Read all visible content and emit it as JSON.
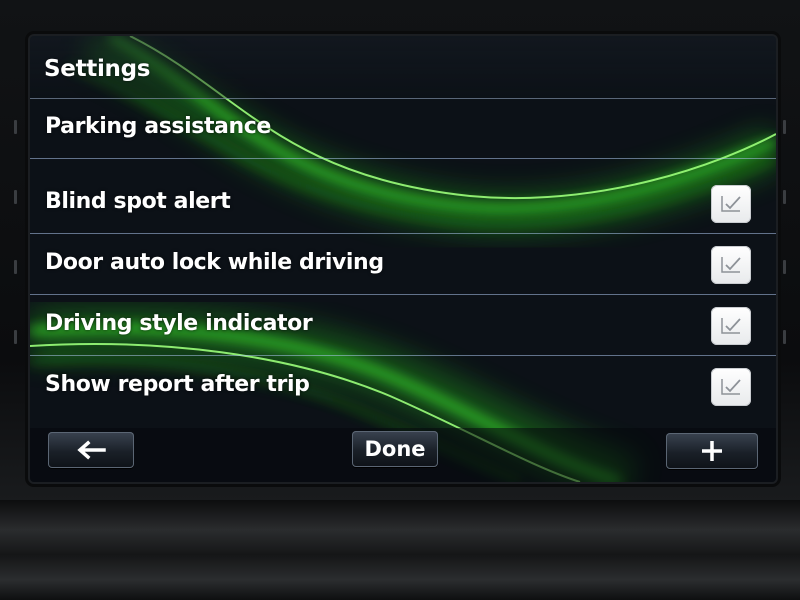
{
  "header": {
    "title": "Settings"
  },
  "rows": [
    {
      "label": "Parking assistance",
      "checked": null
    },
    {
      "label": "Blind spot alert",
      "checked": true
    },
    {
      "label": "Door auto lock while driving",
      "checked": true
    },
    {
      "label": "Driving style indicator",
      "checked": true
    },
    {
      "label": "Show report after trip",
      "checked": true
    }
  ],
  "footer": {
    "back_icon": "arrow-left-icon",
    "done_label": "Done",
    "add_icon": "plus-icon"
  },
  "colors": {
    "accent_green": "#3dff2a",
    "text": "#ffffff",
    "separator": "#aac3eb"
  }
}
